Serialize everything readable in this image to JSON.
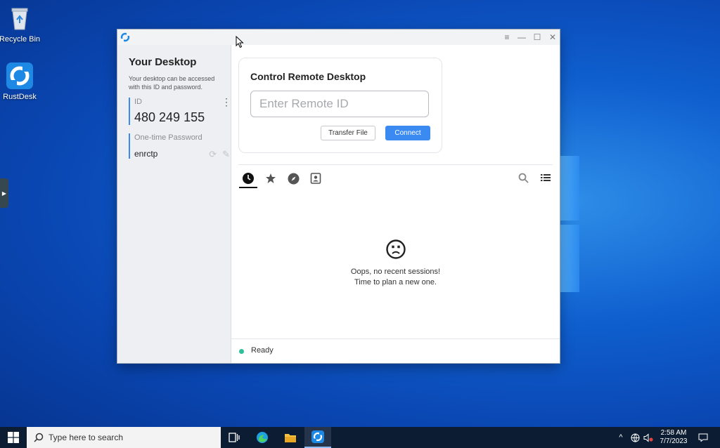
{
  "desktop": {
    "icons": [
      {
        "label": "Recycle Bin",
        "icon": "recycle-bin-icon"
      },
      {
        "label": "RustDesk",
        "icon": "rustdesk-icon"
      }
    ]
  },
  "window": {
    "title_buttons": [
      "menu-icon",
      "minimize-icon",
      "maximize-icon",
      "close-icon"
    ]
  },
  "left_panel": {
    "title": "Your Desktop",
    "description": "Your desktop can be accessed with this ID and password.",
    "id_label": "ID",
    "id_value": "480 249 155",
    "password_label": "One-time Password",
    "password_value": "enrctp"
  },
  "control": {
    "title": "Control Remote Desktop",
    "id_placeholder": "Enter Remote ID",
    "id_value": "",
    "transfer_label": "Transfer File",
    "connect_label": "Connect"
  },
  "tabs": [
    {
      "name": "recent-sessions",
      "icon": "clock-icon",
      "active": true
    },
    {
      "name": "favorites",
      "icon": "star-icon",
      "active": false
    },
    {
      "name": "discovered",
      "icon": "compass-icon",
      "active": false
    },
    {
      "name": "address-book",
      "icon": "contact-icon",
      "active": false
    }
  ],
  "empty_state": {
    "line1": "Oops, no recent sessions!",
    "line2": "Time to plan a new one."
  },
  "status": {
    "text": "Ready",
    "color": "#2fbf9b"
  },
  "taskbar": {
    "search_placeholder": "Type here to search",
    "time": "2:58 AM",
    "date": "7/7/2023"
  },
  "colors": {
    "accent": "#3b8af2"
  }
}
